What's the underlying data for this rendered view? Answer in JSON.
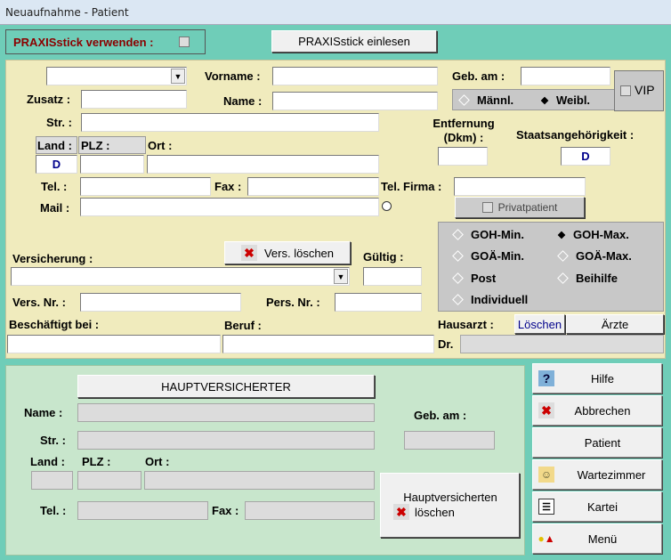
{
  "window": {
    "title": "Neuaufnahme - Patient"
  },
  "praxisstick": {
    "use_label": "PRAXISstick verwenden :",
    "read_button": "PRAXISstick einlesen"
  },
  "patient": {
    "vorname_label": "Vorname :",
    "zusatz_label": "Zusatz :",
    "name_label": "Name :",
    "geb_label": "Geb. am :",
    "gender_male": "Männl.",
    "gender_female": "Weibl.",
    "vip_label": "VIP",
    "str_label": "Str. :",
    "entfernung_label": "Entfernung (Dkm) :",
    "staat_label": "Staatsangehörigkeit :",
    "staat_value": "D",
    "land_label": "Land :",
    "land_value": "D",
    "plz_label": "PLZ :",
    "ort_label": "Ort :",
    "tel_label": "Tel. :",
    "fax_label": "Fax :",
    "tel_firma_label": "Tel. Firma :",
    "mail_label": "Mail :",
    "privatpatient_label": "Privatpatient"
  },
  "insurance": {
    "versicherung_label": "Versicherung :",
    "vers_loeschen": "Vers. löschen",
    "gueltig_label": "Gültig :",
    "vers_nr_label": "Vers. Nr. :",
    "pers_nr_label": "Pers. Nr. :",
    "beschaeftigt_label": "Beschäftigt bei :",
    "beruf_label": "Beruf :",
    "hausarzt_label": "Hausarzt :",
    "loeschen": "Löschen",
    "aerzte": "Ärzte",
    "dr_label": "Dr."
  },
  "billing": {
    "options": [
      "GOH-Min.",
      "GOH-Max.",
      "GOÄ-Min.",
      "GOÄ-Max.",
      "Post",
      "Beihilfe",
      "Individuell"
    ],
    "selected": "GOH-Max."
  },
  "hauptversicherter": {
    "button": "HAUPTVERSICHERTER",
    "name_label": "Name :",
    "geb_label": "Geb. am :",
    "str_label": "Str. :",
    "land_label": "Land :",
    "plz_label": "PLZ :",
    "ort_label": "Ort :",
    "tel_label": "Tel. :",
    "fax_label": "Fax :",
    "loeschen_line1": "Hauptversicherten",
    "loeschen_line2": "löschen"
  },
  "menu": {
    "hilfe": "Hilfe",
    "abbrechen": "Abbrechen",
    "patient": "Patient",
    "wartezimmer": "Wartezimmer",
    "kartei": "Kartei",
    "menue": "Menü"
  },
  "colors": {
    "background": "#6fcdb8",
    "top_panel": "#f0ebbd",
    "bottom_panel": "#c8e6cc"
  }
}
